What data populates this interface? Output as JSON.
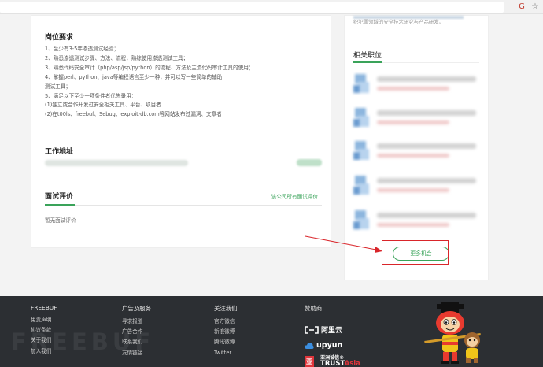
{
  "browser": {
    "ext_icon_1": "G",
    "ext_icon_2": "☆"
  },
  "job": {
    "requirements_title": "岗位要求",
    "requirements": [
      "1、至少有3-5年渗透测试经验；",
      "2、熟悉渗透测试步骤、方法、流程，熟练使用渗透测试工具；",
      "3、熟悉代码安全审计（php/asp/jsp/python）的流程、方法及主流代码审计工具的使用；",
      "4、掌握perl、python、java等编程语言至少一种，并可以写一些简单的辅助",
      "测试工具；",
      "5、满足以下至少一项条件者优先录用：",
      "(1)独立或合作开发过安全相关工具、平台、项目者",
      "(2)在t00ls、freebuf、Sebug、exploit-db.com等网站发布过漏洞、文章者"
    ],
    "address_title": "工作地址",
    "review_title": "面试评价",
    "review_link": "该公司所有面试评价",
    "no_review": "暂无面试评价"
  },
  "sidebar": {
    "top_text": "织犯罪领域的安全技术研究与产品研发。",
    "title": "相关职位",
    "items_count_label": "",
    "more_button": "更多机会"
  },
  "footer": {
    "columns": [
      {
        "head": "FREEBUF",
        "links": [
          "免责声明",
          "协议条款",
          "关于我们",
          "加入我们"
        ]
      },
      {
        "head": "广告及服务",
        "links": [
          "寻求报道",
          "广告合作",
          "联系我们",
          "友情链接"
        ]
      },
      {
        "head": "关注我们",
        "links": [
          "官方微信",
          "新浪微博",
          "腾讯微博",
          "Twitter"
        ]
      }
    ],
    "sponsor_head": "赞助商",
    "sponsors": {
      "aliyun": "阿里云",
      "upyun": "upyun",
      "trust_cn": "亚洲诚信®",
      "trust_en_1": "TRUST",
      "trust_en_2": "Asia"
    },
    "watermark": "FREEBUF"
  },
  "colors": {
    "accent": "#3aa35a",
    "highlight": "#d9252a",
    "footer_bg": "#2c2f33"
  }
}
